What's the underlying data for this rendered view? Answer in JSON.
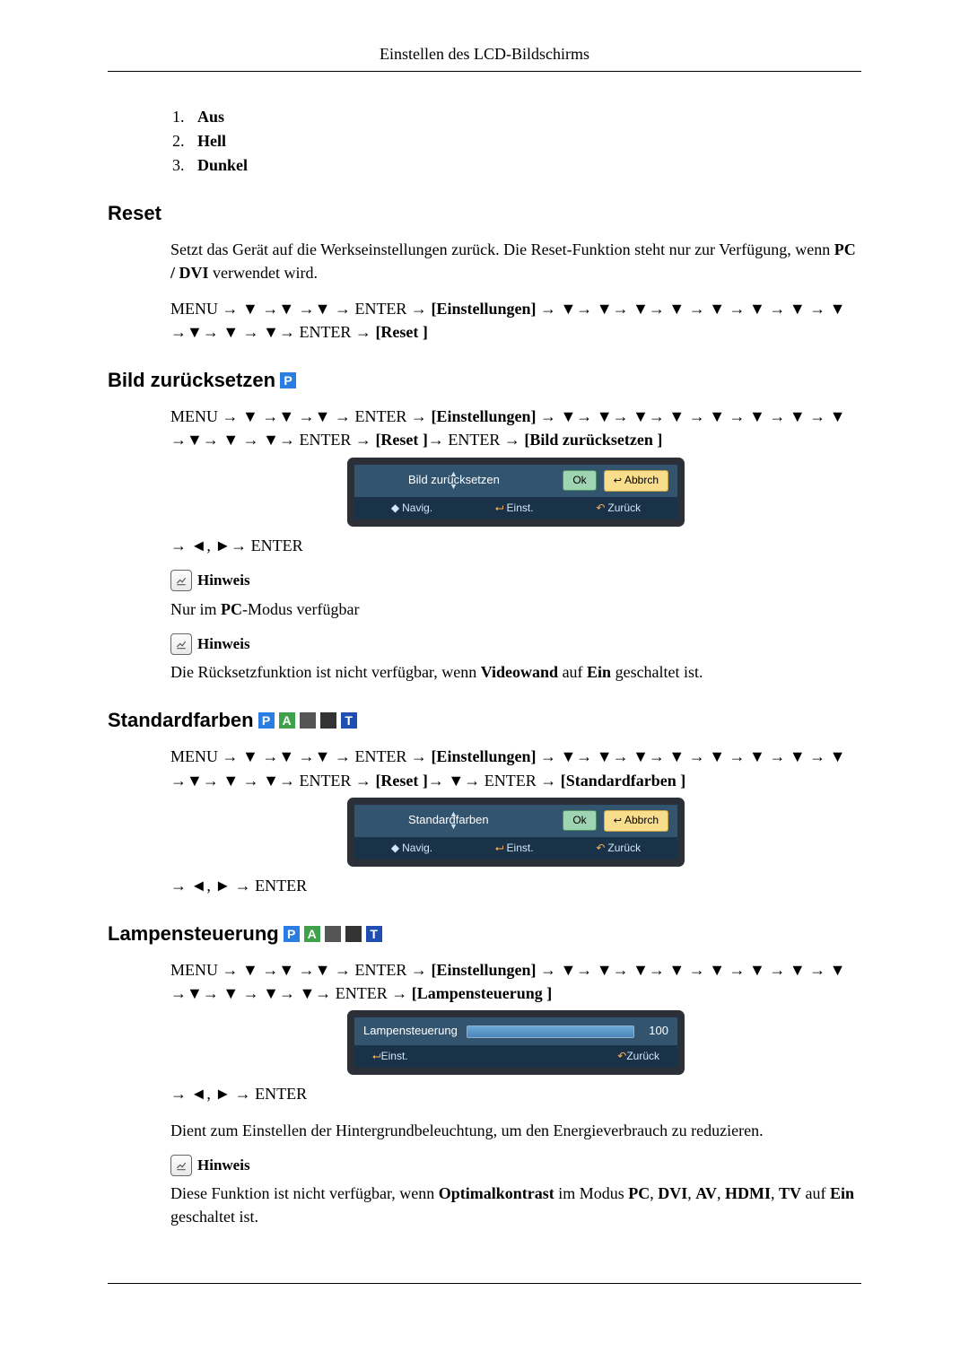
{
  "header": {
    "title": "Einstellen des LCD-Bildschirms"
  },
  "list": {
    "items": [
      "Aus",
      "Hell",
      "Dunkel"
    ]
  },
  "reset": {
    "heading": "Reset",
    "desc_a": "Setzt das Gerät auf die Werkseinstellungen zurück. Die Reset-Funktion steht nur zur Verfügung, wenn ",
    "desc_b": "PC / DVI",
    "desc_c": " verwendet wird.",
    "seq_a": "MENU → ▼ →▼ →▼ → ENTER → ",
    "seq_set": "[Einstellungen]",
    "seq_b": " → ▼→ ▼→ ▼→ ▼ → ▼ → ▼ → ▼ → ▼ →▼→ ▼ → ▼→ ENTER → ",
    "seq_reset": "[Reset ]"
  },
  "bild": {
    "heading": "Bild zurücksetzen",
    "seq_a": "MENU → ▼ →▼ →▼ → ENTER → ",
    "seq_set": "[Einstellungen]",
    "seq_b": " → ▼→ ▼→ ▼→ ▼ → ▼ → ▼ → ▼ → ▼ →▼→ ▼ → ▼→ ENTER → ",
    "seq_reset": "[Reset ]",
    "seq_c": "→ ENTER → ",
    "seq_target": "[Bild zurücksetzen ]",
    "osd": {
      "title": "Bild zurücksetzen",
      "ok": "Ok",
      "cancel": "Abbrch",
      "nav": "Navig.",
      "enter": "Einst.",
      "back": "Zurück"
    },
    "post": "→ ◄, ►→ ENTER",
    "note_label": "Hinweis",
    "note1_a": "Nur im ",
    "note1_b": "PC",
    "note1_c": "-Modus verfügbar",
    "note2_a": "Die Rücksetzfunktion ist nicht verfügbar, wenn ",
    "note2_b": "Videowand",
    "note2_c": " auf ",
    "note2_d": "Ein",
    "note2_e": " geschaltet ist."
  },
  "standard": {
    "heading": "Standardfarben",
    "seq_a": "MENU → ▼ →▼ →▼ → ENTER → ",
    "seq_set": "[Einstellungen]",
    "seq_b": " → ▼→ ▼→ ▼→ ▼ → ▼ → ▼ → ▼ → ▼ →▼→ ▼ → ▼→ ENTER → ",
    "seq_reset": "[Reset ]",
    "seq_c": "→ ▼→ ENTER → ",
    "seq_target": "[Standardfarben ]",
    "osd": {
      "title": "Standardfarben",
      "ok": "Ok",
      "cancel": "Abbrch",
      "nav": "Navig.",
      "enter": "Einst.",
      "back": "Zurück"
    },
    "post": "→ ◄, ► → ENTER"
  },
  "lamp": {
    "heading": "Lampensteuerung",
    "seq_a": "MENU → ▼ →▼ →▼ → ENTER → ",
    "seq_set": "[Einstellungen]",
    "seq_b": " → ▼→ ▼→ ▼→ ▼ → ▼ → ▼ → ▼ → ▼ →▼→ ▼ → ▼→ ▼→ ENTER → ",
    "seq_target": "[Lampensteuerung ]",
    "osd": {
      "title": "Lampensteuerung",
      "value": "100",
      "enter": "Einst.",
      "back": "Zurück"
    },
    "post": "→ ◄, ► → ENTER",
    "desc": "Dient zum Einstellen der Hintergrundbeleuchtung, um den Energieverbrauch zu reduzieren.",
    "note_label": "Hinweis",
    "note_a": "Diese Funktion ist nicht verfügbar, wenn ",
    "note_b": "Optimalkontrast ",
    "note_c": " im Modus ",
    "note_d": "PC",
    "note_e": ", ",
    "note_f": "DVI",
    "note_g": ", ",
    "note_h": "AV",
    "note_i": ", ",
    "note_j": "HDMI",
    "note_k": ", ",
    "note_l": "TV",
    "note_m": " auf ",
    "note_n": "Ein",
    "note_o": " geschaltet ist."
  }
}
